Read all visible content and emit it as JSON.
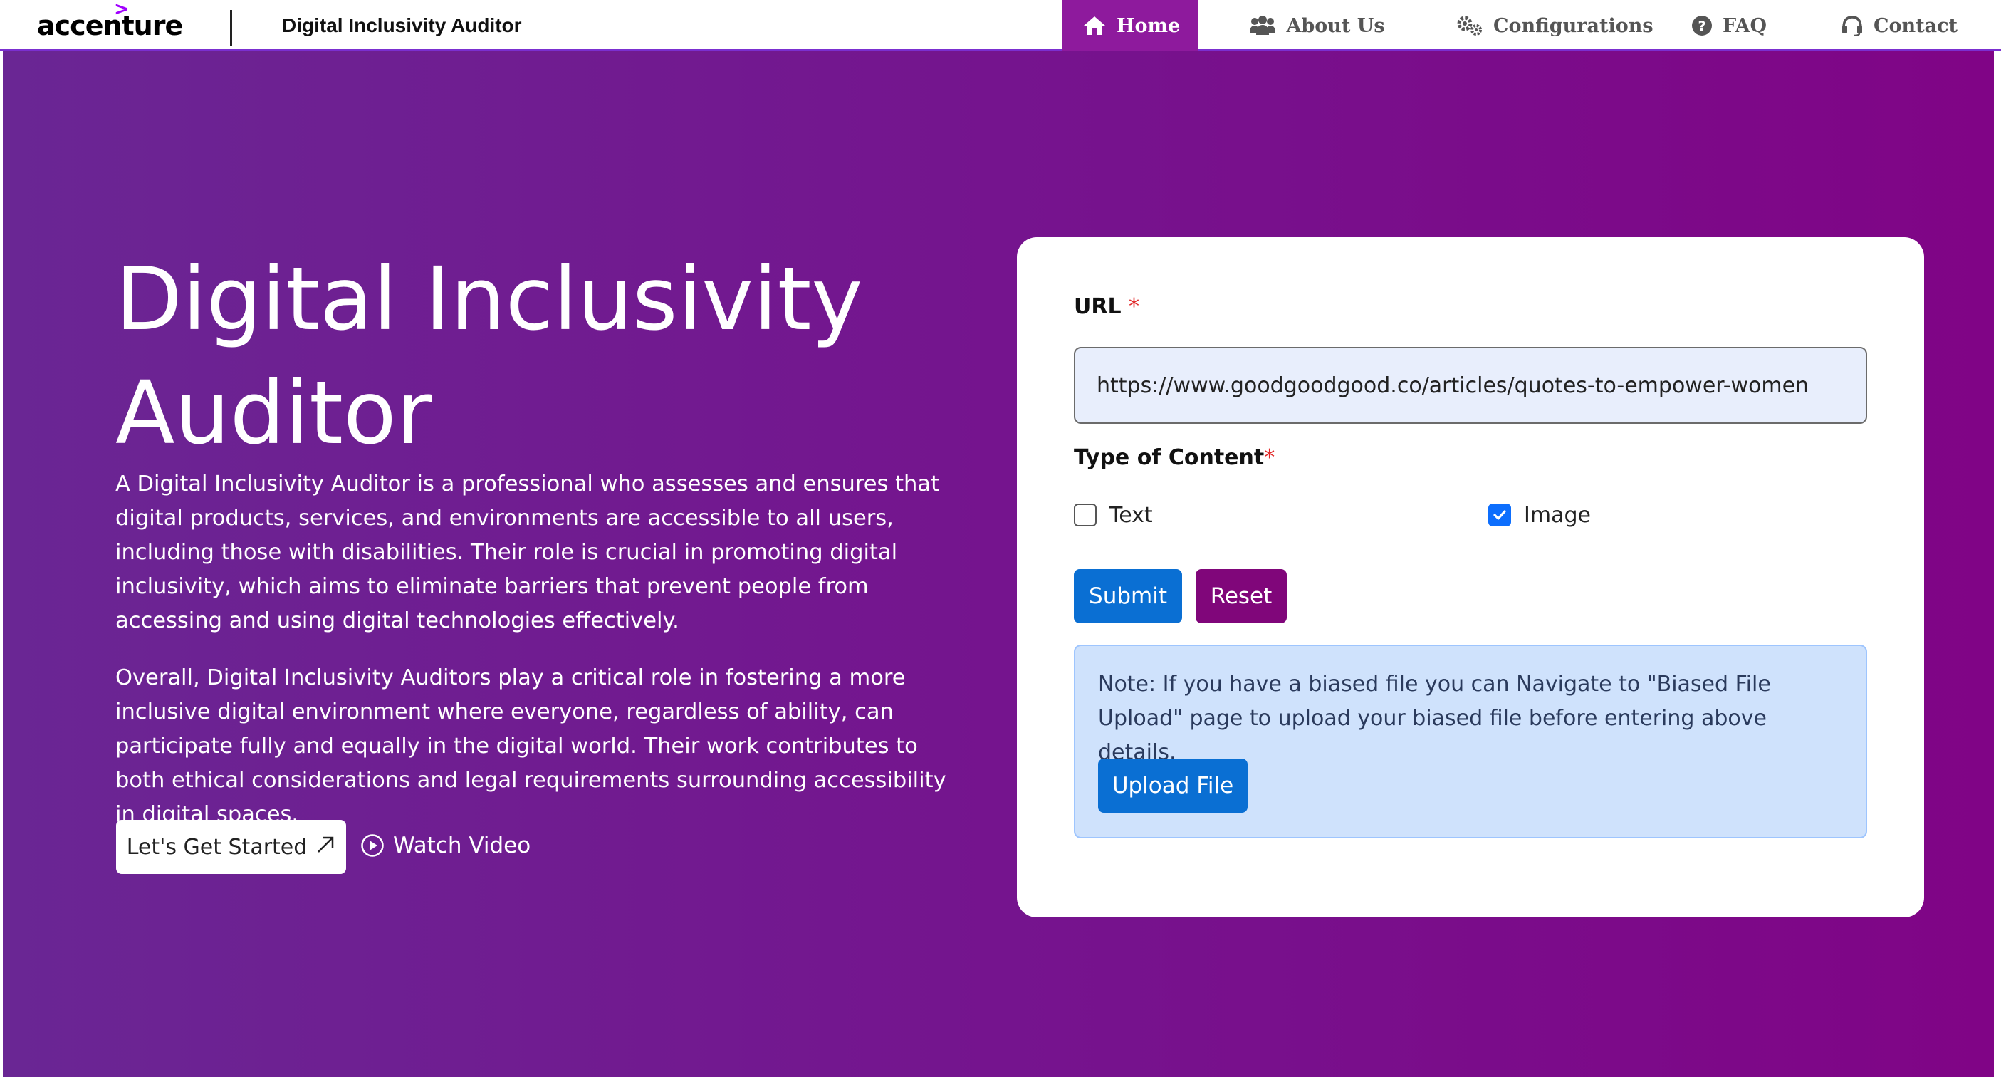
{
  "brand": {
    "logo_text": "accenture",
    "logo_mark": ">",
    "app_title": "Digital Inclusivity Auditor"
  },
  "nav": {
    "items": [
      {
        "label": "Home",
        "icon": "home-icon",
        "active": true
      },
      {
        "label": "About Us",
        "icon": "users-icon",
        "active": false
      },
      {
        "label": "Configurations",
        "icon": "gears-icon",
        "active": false
      },
      {
        "label": "FAQ",
        "icon": "question-circle-icon",
        "active": false
      },
      {
        "label": "Contact",
        "icon": "headset-icon",
        "active": false
      }
    ]
  },
  "hero": {
    "title": "Digital Inclusivity Auditor",
    "paragraph1": "A Digital Inclusivity Auditor is a professional who assesses and ensures that digital products, services, and environments are accessible to all users, including those with disabilities. Their role is crucial in promoting digital inclusivity, which aims to eliminate barriers that prevent people from accessing and using digital technologies effectively.",
    "paragraph2": "Overall, Digital Inclusivity Auditors play a critical role in fostering a more inclusive digital environment where everyone, regardless of ability, can participate fully and equally in the digital world. Their work contributes to both ethical considerations and legal requirements surrounding accessibility in digital spaces.",
    "cta_label": "Let's Get Started",
    "cta_icon": "arrow-up-right-icon",
    "video_label": "Watch Video",
    "video_icon": "play-circle-icon"
  },
  "form": {
    "url_label": "URL",
    "required_mark": "*",
    "url_value": "https://www.goodgoodgood.co/articles/quotes-to-empower-women",
    "type_label": "Type of Content",
    "options": [
      {
        "label": "Text",
        "checked": false
      },
      {
        "label": "Image",
        "checked": true
      }
    ],
    "submit_label": "Submit",
    "reset_label": "Reset",
    "note_text": "Note: If you have a biased file you can Navigate to \"Biased File Upload\" page to upload your biased file before entering above details.",
    "upload_label": "Upload File"
  },
  "colors": {
    "nav_active": "#8e1a9d",
    "nav_border": "#7b2fd0",
    "hero_gradient_start": "#6a2694",
    "hero_gradient_end": "#800486",
    "primary_button": "#0a6fd3",
    "reset_button": "#80067a",
    "note_background": "#cfe2fc",
    "checkbox_checked": "#0d6efd",
    "required_mark": "#e22828"
  }
}
